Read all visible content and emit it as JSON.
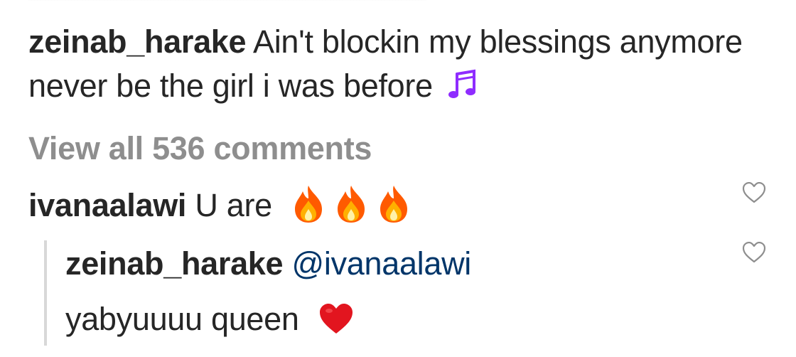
{
  "caption": {
    "username": "zeinab_harake",
    "text": "Ain't blockin my blessings anymore never be the girl i was before",
    "emoji": "musical-notes-icon"
  },
  "view_all_comments": "View all 536 comments",
  "comments": [
    {
      "username": "ivanaalawi",
      "text": "U are",
      "emoji": [
        "fire-icon",
        "fire-icon",
        "fire-icon"
      ],
      "like_icon": "heart-outline-icon",
      "reply": {
        "username": "zeinab_harake",
        "mention": "@ivanaalawi",
        "text": "yabyuuuu queen",
        "emoji": "red-heart-icon",
        "like_icon": "heart-outline-icon"
      }
    }
  ],
  "colors": {
    "text": "#262626",
    "muted": "#8e8e8e",
    "mention": "#003569",
    "heart_outline": "#8e8e8e",
    "thread_line": "#d8d8d8"
  }
}
